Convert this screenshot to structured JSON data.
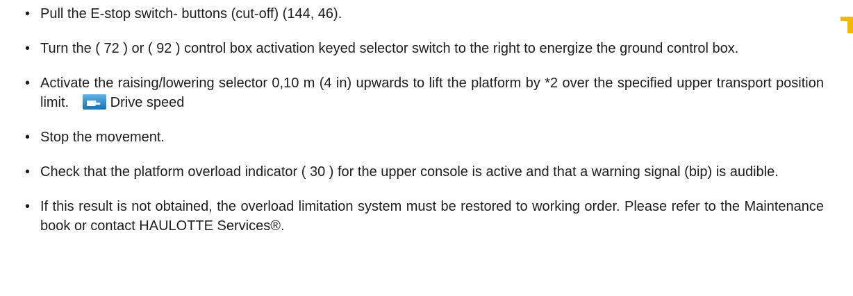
{
  "items": [
    {
      "text": "Pull the E-stop switch- buttons (cut-off) (144, 46)."
    },
    {
      "text": "Turn the ( 72 ) or ( 92 ) control box activation keyed selector switch to the right to energize the ground control box."
    },
    {
      "text": "Activate the raising/lowering selector  0,10 m (4 in) upwards to lift the platform by *2 over the specified upper transport position limit.",
      "link_icon": "pointing-hand-icon",
      "link_text": "Drive speed"
    },
    {
      "text": "Stop the movement."
    },
    {
      "text": "Check that the platform overload indicator ( 30 ) for the upper console is active and that a warning signal (bip) is audible."
    },
    {
      "text": "If this result is not obtained, the overload limitation system must be restored to working order.  Please refer to the Maintenance book or contact HAULOTTE Services®."
    }
  ],
  "bullet_char": "•",
  "colors": {
    "text": "#1c1c1c",
    "icon_blue": "#1e7fc0",
    "corner_mark": "#f5b800"
  }
}
